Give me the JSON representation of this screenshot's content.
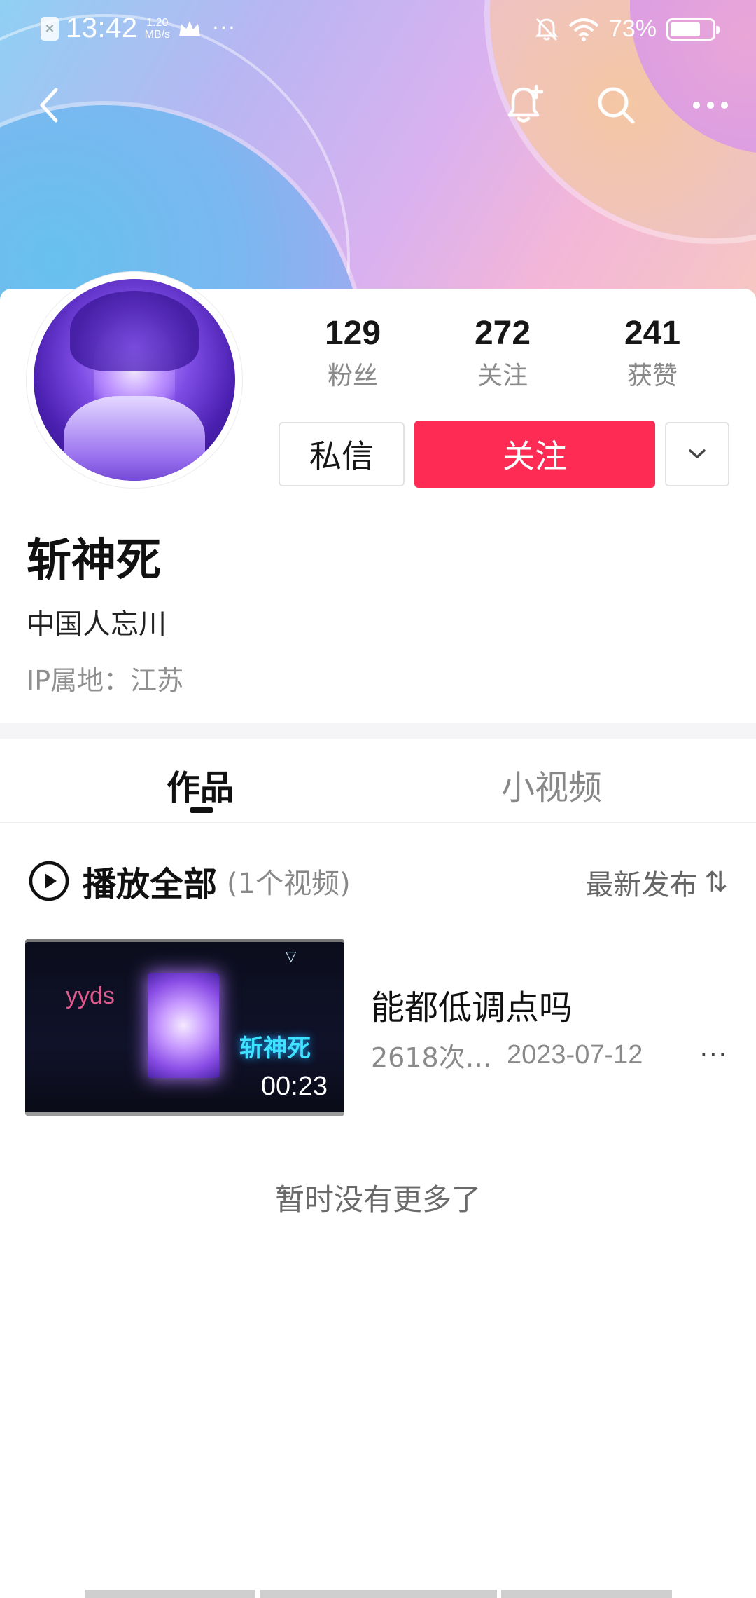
{
  "status_bar": {
    "time": "13:42",
    "speed_value": "1.20",
    "speed_unit": "MB/s",
    "overflow": "···",
    "battery_percent": "73%",
    "battery_level": 0.73
  },
  "profile": {
    "stats": [
      {
        "value": "129",
        "label": "粉丝"
      },
      {
        "value": "272",
        "label": "关注"
      },
      {
        "value": "241",
        "label": "获赞"
      }
    ],
    "message_button": "私信",
    "follow_button": "关注",
    "nickname": "斩神死",
    "bio": "中国人忘川",
    "ip_location": "IP属地：江苏"
  },
  "tabs": [
    {
      "label": "作品",
      "active": true
    },
    {
      "label": "小视频",
      "active": false
    }
  ],
  "list_header": {
    "play_all": "播放全部",
    "count": "(1个视频)",
    "sort_label": "最新发布",
    "sort_icon": "⇅"
  },
  "videos": [
    {
      "title": "能都低调点吗",
      "plays": "2618次…",
      "date": "2023-07-12",
      "duration": "00:23",
      "thumb_text_1": "yyds",
      "thumb_text_2": "斩神死",
      "more": "···"
    }
  ],
  "empty_text": "暂时没有更多了",
  "colors": {
    "follow_button": "#fe2c55",
    "secondary_text": "#8a8a8a"
  },
  "icons": [
    "back-icon",
    "bell-plus-icon",
    "search-icon",
    "more-icon",
    "chevron-down-icon",
    "play-circle-icon",
    "sort-icon"
  ]
}
